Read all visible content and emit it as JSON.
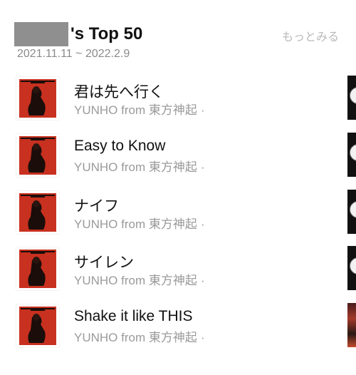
{
  "header": {
    "title": "'s Top 50",
    "more_label": "もっとみる",
    "date_range": "2021.11.11 ~ 2022.2.9"
  },
  "tracks": [
    {
      "title": "君は先へ行く",
      "artist": "YUNHO from 東方神起",
      "separator": "·"
    },
    {
      "title": "Easy to Know",
      "artist": "YUNHO from 東方神起",
      "separator": "·"
    },
    {
      "title": "ナイフ",
      "artist": "YUNHO from 東方神起",
      "separator": "·"
    },
    {
      "title": "サイレン",
      "artist": "YUNHO from 東方神起",
      "separator": "·"
    },
    {
      "title": "Shake it like THIS",
      "artist": "YUNHO from 東方神起",
      "separator": "·"
    }
  ],
  "colors": {
    "cover_red": "#c8301f",
    "cover_dark": "#1a0d0a",
    "muted_text": "#9a9a9a"
  }
}
